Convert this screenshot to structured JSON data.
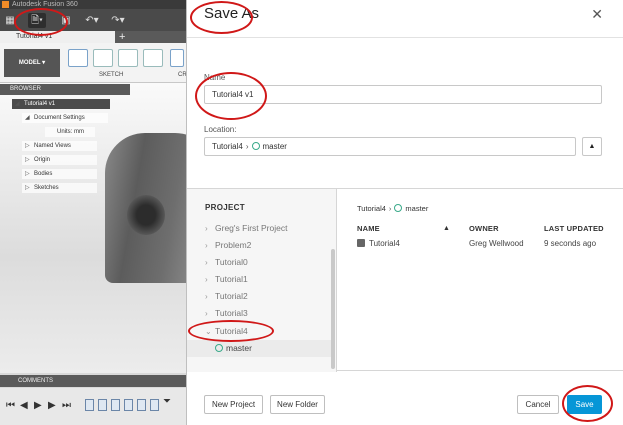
{
  "app": {
    "title": "Autodesk Fusion 360",
    "tab_label": "Tutorial4 v1",
    "tab_plus": "+",
    "workspace": "MODEL",
    "toolbar": {
      "sketch_label": "SKETCH",
      "create_label_partial": "CR"
    },
    "browser": {
      "header": "BROWSER",
      "items": [
        {
          "label": "Tutorial4 v1"
        },
        {
          "label": "Document Settings"
        },
        {
          "label": "Units: mm"
        },
        {
          "label": "Named Views"
        },
        {
          "label": "Origin"
        },
        {
          "label": "Bodies"
        },
        {
          "label": "Sketches"
        }
      ]
    },
    "comments_label": "COMMENTS"
  },
  "dialog": {
    "title": "Save As",
    "close_glyph": "✕",
    "name_label": "Name",
    "name_value": "Tutorial4 v1",
    "location_label": "Location:",
    "location": {
      "project": "Tutorial4",
      "separator": "›",
      "folder": "master"
    },
    "location_toggle_glyph": "▲",
    "projects": {
      "header": "PROJECT",
      "items": [
        {
          "label": "Greg's First Project",
          "arrow": "›"
        },
        {
          "label": "Problem2",
          "arrow": "›"
        },
        {
          "label": "Tutorial0",
          "arrow": "›"
        },
        {
          "label": "Tutorial1",
          "arrow": "›"
        },
        {
          "label": "Tutorial2",
          "arrow": "›"
        },
        {
          "label": "Tutorial3",
          "arrow": "›"
        },
        {
          "label": "Tutorial4",
          "arrow": "⌄"
        }
      ],
      "branch": "master"
    },
    "files": {
      "breadcrumb": {
        "project": "Tutorial4",
        "separator": "›",
        "folder": "master"
      },
      "columns": {
        "name": "NAME",
        "owner": "OWNER",
        "updated": "LAST UPDATED"
      },
      "sort_glyph": "▲",
      "rows": [
        {
          "name": "Tutorial4",
          "owner": "Greg Wellwood",
          "updated": "9 seconds ago"
        }
      ]
    },
    "buttons": {
      "new_project": "New Project",
      "new_folder": "New Folder",
      "cancel": "Cancel",
      "save": "Save"
    }
  },
  "colors": {
    "save_button": "#0696d7",
    "highlight_ring": "#d01818",
    "branch_icon": "#3aaa8a"
  }
}
